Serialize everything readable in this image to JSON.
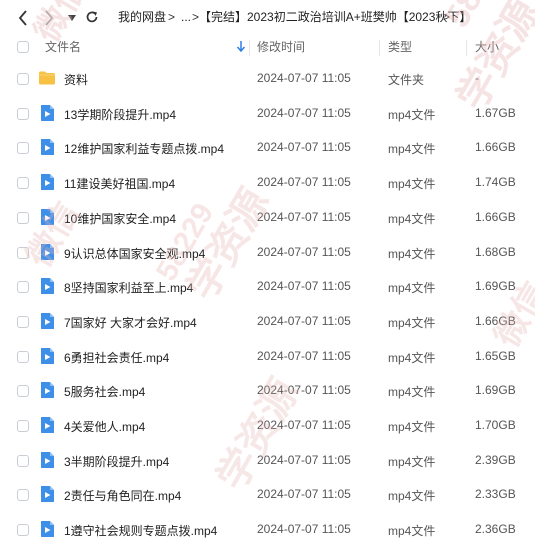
{
  "breadcrumb": {
    "root": "我的网盘",
    "ellipsis": "...",
    "current": "【完结】2023初二政治培训A+班樊帅【2023秋下】"
  },
  "columns": {
    "name": "文件名",
    "modified": "修改时间",
    "type": "类型",
    "size": "大小"
  },
  "files": [
    {
      "name": "资料",
      "modified": "2024-07-07 11:05",
      "type": "文件夹",
      "size": "-",
      "icon": "folder-icon"
    },
    {
      "name": "13学期阶段提升.mp4",
      "modified": "2024-07-07 11:05",
      "type": "mp4文件",
      "size": "1.67GB",
      "icon": "video-file-icon"
    },
    {
      "name": "12维护国家利益专题点拨.mp4",
      "modified": "2024-07-07 11:05",
      "type": "mp4文件",
      "size": "1.66GB",
      "icon": "video-file-icon"
    },
    {
      "name": "11建设美好祖国.mp4",
      "modified": "2024-07-07 11:05",
      "type": "mp4文件",
      "size": "1.74GB",
      "icon": "video-file-icon"
    },
    {
      "name": "10维护国家安全.mp4",
      "modified": "2024-07-07 11:05",
      "type": "mp4文件",
      "size": "1.66GB",
      "icon": "video-file-icon"
    },
    {
      "name": "9认识总体国家安全观.mp4",
      "modified": "2024-07-07 11:05",
      "type": "mp4文件",
      "size": "1.68GB",
      "icon": "video-file-icon"
    },
    {
      "name": "8坚持国家利益至上.mp4",
      "modified": "2024-07-07 11:05",
      "type": "mp4文件",
      "size": "1.69GB",
      "icon": "video-file-icon"
    },
    {
      "name": "7国家好 大家才会好.mp4",
      "modified": "2024-07-07 11:05",
      "type": "mp4文件",
      "size": "1.66GB",
      "icon": "video-file-icon"
    },
    {
      "name": "6勇担社会责任.mp4",
      "modified": "2024-07-07 11:05",
      "type": "mp4文件",
      "size": "1.65GB",
      "icon": "video-file-icon"
    },
    {
      "name": "5服务社会.mp4",
      "modified": "2024-07-07 11:05",
      "type": "mp4文件",
      "size": "1.69GB",
      "icon": "video-file-icon"
    },
    {
      "name": "4关爱他人.mp4",
      "modified": "2024-07-07 11:05",
      "type": "mp4文件",
      "size": "1.70GB",
      "icon": "video-file-icon"
    },
    {
      "name": "3半期阶段提升.mp4",
      "modified": "2024-07-07 11:05",
      "type": "mp4文件",
      "size": "2.39GB",
      "icon": "video-file-icon"
    },
    {
      "name": "2责任与角色同在.mp4",
      "modified": "2024-07-07 11:05",
      "type": "mp4文件",
      "size": "2.33GB",
      "icon": "video-file-icon"
    },
    {
      "name": "1遵守社会规则专题点拨.mp4",
      "modified": "2024-07-07 11:05",
      "type": "mp4文件",
      "size": "2.36GB",
      "icon": "video-file-icon"
    }
  ],
  "watermark": {
    "text_a": "微信",
    "text_b": "学资源",
    "digits": "58229",
    "color": "#e8b4b4"
  },
  "colors": {
    "folder": "#f7c244",
    "video": "#3d8fe8",
    "sort_arrow": "#2f7fe6"
  }
}
